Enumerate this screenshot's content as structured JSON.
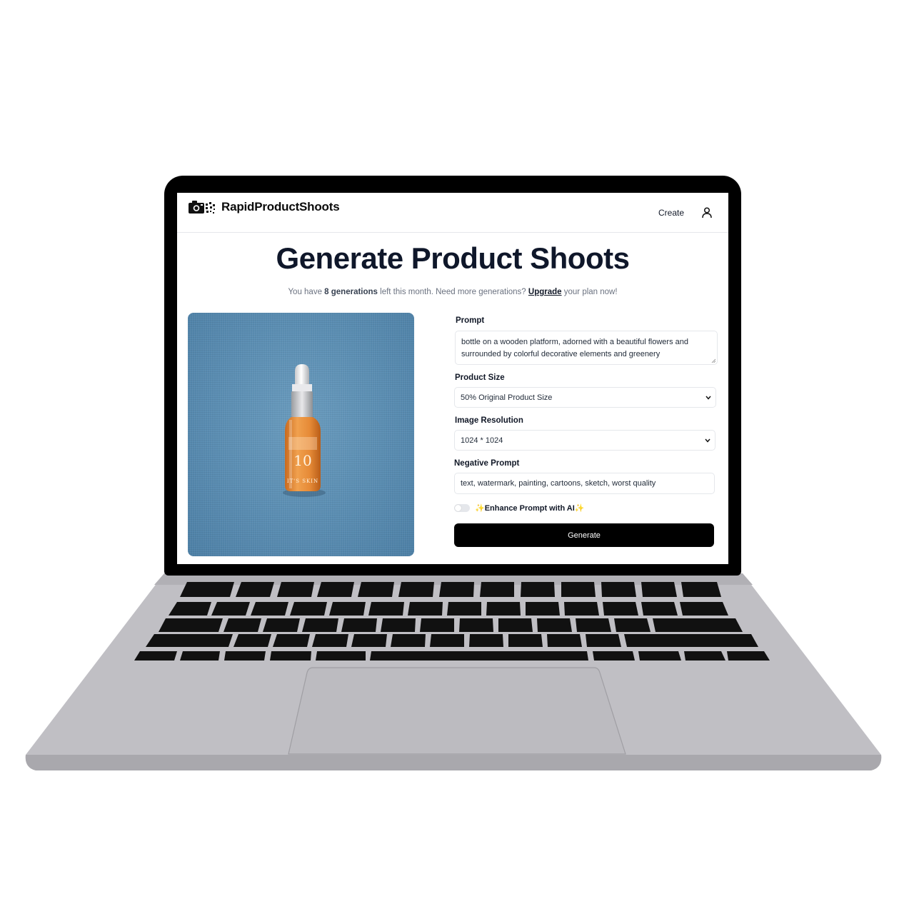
{
  "app": {
    "brand": "RapidProductShoots",
    "nav": {
      "create_label": "Create"
    }
  },
  "page": {
    "title": "Generate Product Shoots",
    "subtitle": {
      "prefix": "You have ",
      "count": "8 generations",
      "middle": " left this month. Need more generations? ",
      "link": "Upgrade",
      "suffix": " your plan now!"
    }
  },
  "product_image": {
    "bottle_number": "10",
    "brand_mark": "IT'S SKIN"
  },
  "form": {
    "prompt": {
      "label": "Prompt",
      "value": "bottle on a wooden platform, adorned with a beautiful flowers and surrounded by colorful decorative elements and greenery"
    },
    "product_size": {
      "label": "Product Size",
      "selected": "50% Original Product Size"
    },
    "image_resolution": {
      "label": "Image Resolution",
      "selected": "1024 * 1024"
    },
    "negative_prompt": {
      "label": "Negative Prompt",
      "value": "text, watermark, painting, cartoons, sketch, worst quality"
    },
    "enhance": {
      "sparkle": "✨",
      "label": "Enhance Prompt with AI",
      "enabled": false
    },
    "generate_label": "Generate"
  },
  "colors": {
    "laptop_body": "#c0bfc4",
    "bezel": "#000000",
    "keys": "#111111",
    "photo_background": "#5a8db2",
    "bottle_liquid": "#e8903c"
  }
}
